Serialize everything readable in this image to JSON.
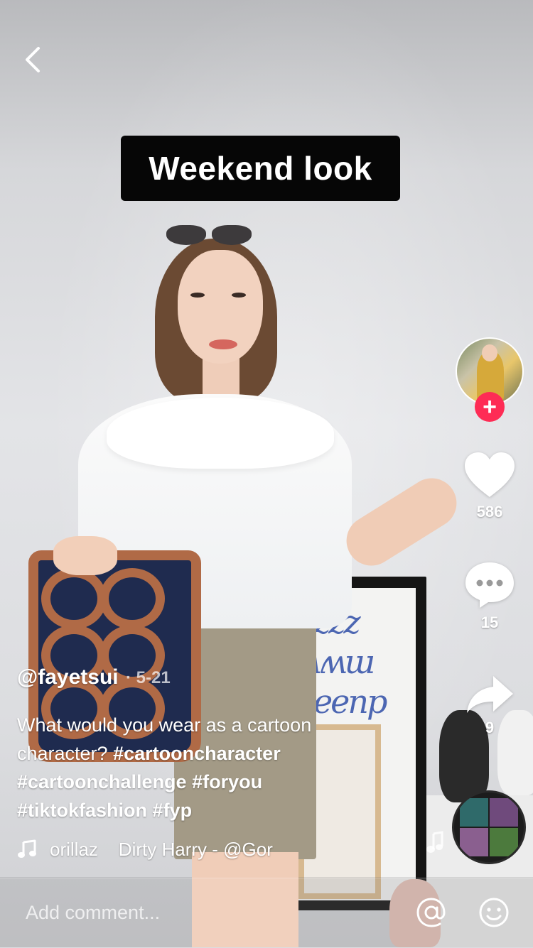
{
  "video": {
    "caption_overlay": "Weekend look"
  },
  "author": {
    "username": "@fayetsui",
    "date": "· 5-21"
  },
  "actions": {
    "likes": "586",
    "comments": "15",
    "shares": "9",
    "follow_symbol": "+"
  },
  "description": {
    "text": "What would you wear as a cartoon character?",
    "hashtags": [
      "#cartooncharacter",
      "#cartoonchallenge",
      "#foryou",
      "#tiktokfashion",
      "#fyp"
    ]
  },
  "music": {
    "title": "orillaz    Dirty Harry - @Gor"
  },
  "comment": {
    "placeholder": "Add comment..."
  },
  "colors": {
    "accent": "#fe2c55",
    "overlay_text": "#ffffff",
    "caption_bg": "#060606"
  },
  "icons": [
    "back-arrow-icon",
    "heart-icon",
    "comment-bubble-icon",
    "share-arrow-icon",
    "music-note-icon",
    "at-sign-icon",
    "emoji-icon"
  ]
}
